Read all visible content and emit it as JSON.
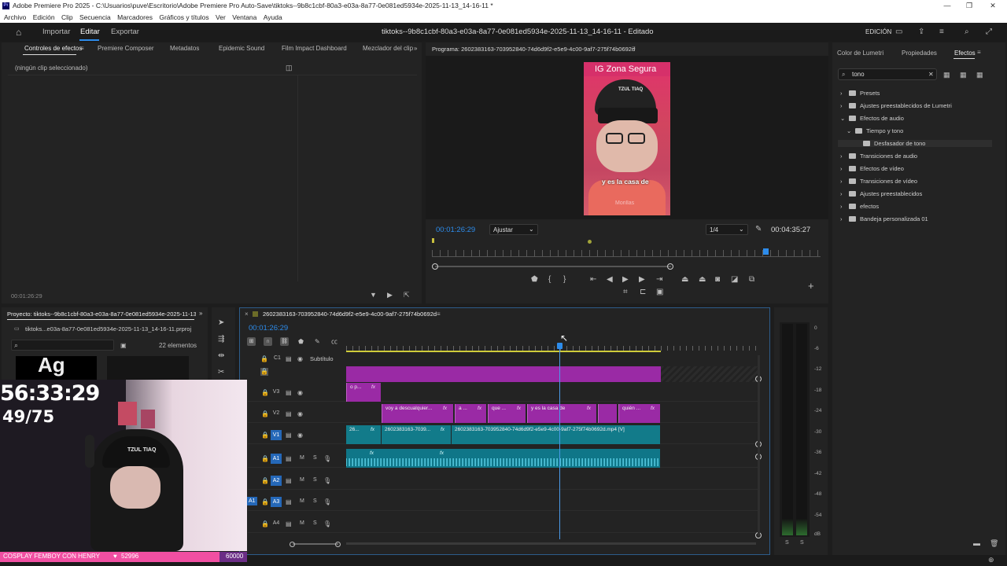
{
  "window": {
    "title": "Adobe Premiere Pro 2025 - C:\\Usuarios\\puve\\Escritorio\\Adobe Premiere Pro Auto-Save\\tiktoks--9b8c1cbf-80a3-e03a-8a77-0e081ed5934e-2025-11-13_14-16-11 *",
    "logo": "Pr"
  },
  "menu": [
    "Archivo",
    "Edición",
    "Clip",
    "Secuencia",
    "Marcadores",
    "Gráficos y títulos",
    "Ver",
    "Ventana",
    "Ayuda"
  ],
  "header": {
    "import": "Importar",
    "edit": "Editar",
    "export": "Exportar",
    "project_title": "tiktoks--9b8c1cbf-80a3-e03a-8a77-0e081ed5934e-2025-11-13_14-16-11 - Editado",
    "workspace": "EDICIÓN"
  },
  "effect_controls": {
    "tabs": [
      "Controles de efectos",
      "Premiere Composer",
      "Metadatos",
      "Epidemic Sound",
      "Film Impact Dashboard",
      "Mezclador del clip"
    ],
    "no_clip": "(ningún clip seleccionado)",
    "timecode": "00:01:26:29"
  },
  "program": {
    "title": "Programa: 2602383163-703952840-74d6d9f2-e5e9-4c00-9af7-275f74b0692d",
    "overlay_top": "IG Zona Segura",
    "caption": "y es la casa de",
    "watermark": "Morillas",
    "timecode": "00:01:26:29",
    "fit": "Ajustar",
    "resolution": "1/4",
    "duration": "00:04:35:27"
  },
  "right_panel": {
    "tabs": [
      "Color de Lumetri",
      "Propiedades",
      "Efectos"
    ],
    "search": "tono",
    "tree": [
      {
        "label": "Presets",
        "indent": 0,
        "arrow": "›"
      },
      {
        "label": "Ajustes preestablecidos de Lumetri",
        "indent": 0,
        "arrow": "›"
      },
      {
        "label": "Efectos de audio",
        "indent": 0,
        "arrow": "⌄"
      },
      {
        "label": "Tiempo y tono",
        "indent": 1,
        "arrow": "⌄"
      },
      {
        "label": "Desfasador de tono",
        "indent": 2,
        "arrow": ""
      },
      {
        "label": "Transiciones de audio",
        "indent": 0,
        "arrow": "›"
      },
      {
        "label": "Efectos de vídeo",
        "indent": 0,
        "arrow": "›"
      },
      {
        "label": "Transiciones de vídeo",
        "indent": 0,
        "arrow": "›"
      },
      {
        "label": "Ajustes preestablecidos",
        "indent": 0,
        "arrow": "›"
      },
      {
        "label": "efectos",
        "indent": 0,
        "arrow": "›"
      },
      {
        "label": "Bandeja personalizada 01",
        "indent": 0,
        "arrow": "›"
      }
    ]
  },
  "project": {
    "title": "Proyecto: tiktoks--9b8c1cbf-80a3-e03a-8a77-0e081ed5934e-2025-11-13_1...",
    "file": "tiktoks...e03a-8a77-0e081ed5934e-2025-11-13_14-16-11.prproj",
    "count": "22 elementos",
    "thumb_text": "Ag"
  },
  "timeline": {
    "title": "2602383163-703952840-74d6d9f2-e5e9-4c00-9af7-275f74b0692d",
    "timecode": "00:01:26:29",
    "subtitle_track": "Subtítulo",
    "tracks_v": [
      "C1",
      "V3",
      "V2",
      "V1"
    ],
    "tracks_a": [
      "A1",
      "A2",
      "A3",
      "A4"
    ],
    "source_a": "A1",
    "clips": {
      "v3": "o p...",
      "v2": [
        "voy a descualquier...",
        "a ...",
        "que ...",
        "y es la casa de",
        "quién ..."
      ],
      "v1": [
        "26...",
        "2602383163-7039...",
        "2602383163-703952840-74d6d9f2-e5e9-4c00-9af7-275f74b0692d.mp4 [V]"
      ],
      "fx": "fx"
    },
    "meter_labels": [
      "0",
      "-6",
      "-12",
      "-18",
      "-24",
      "-30",
      "-36",
      "-42",
      "-48",
      "-54",
      "dB"
    ],
    "meter_ss": [
      "S",
      "S"
    ]
  },
  "stream_overlay": {
    "timer": "56:33:29",
    "count": "49/75",
    "banner": "COSPLAY FEMBOY CON HENRY",
    "viewers": "52996",
    "goal": "60000",
    "cap_text": "TZUL TIAQ"
  }
}
